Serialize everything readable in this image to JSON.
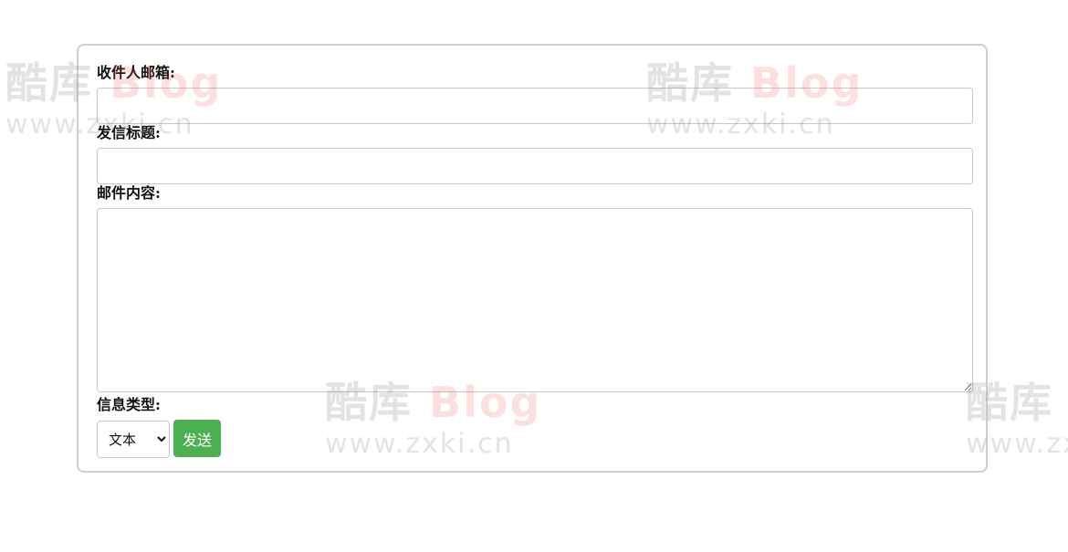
{
  "form": {
    "recipient_label": "收件人邮箱:",
    "recipient_value": "",
    "subject_label": "发信标题:",
    "subject_value": "",
    "content_label": "邮件内容:",
    "content_value": "",
    "type_label": "信息类型:",
    "type_selected": "文本",
    "send_label": "发送"
  },
  "watermark": {
    "logo_cn": "酷库",
    "logo_blog": "Blog",
    "url": "www.zxki.cn"
  },
  "colors": {
    "accent_button": "#4caf50",
    "card_border": "#cfcfcf",
    "input_border": "#c8c8c8"
  }
}
